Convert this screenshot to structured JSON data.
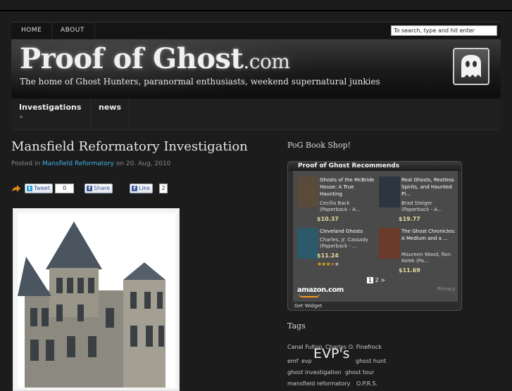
{
  "nav": {
    "home": "HOME",
    "about": "ABOUT",
    "search_placeholder": "To search, type and hit enter"
  },
  "banner": {
    "title_main": "Proof of Ghost",
    "title_suffix": ".com",
    "tagline": "The home of Ghost Hunters, paranormal enthusiasts, weekend supernatural junkies"
  },
  "mainnav": {
    "investigations": "Investigations",
    "investigations_arrow": "»",
    "news": "news"
  },
  "post": {
    "title": "Mansfield Reformatory Investigation",
    "posted_in_label": "Posted in",
    "category": "Mansfield Reformatory",
    "on_label": "on",
    "date": "20. Aug, 2010"
  },
  "share": {
    "tweet_label": "Tweet",
    "tweet_count": "0",
    "share_label": "Share",
    "like_label": "Like",
    "like_count": "2"
  },
  "sidebar": {
    "shop_heading": "PoG Book Shop!",
    "widget_title": "Proof of Ghost Recommends",
    "books": [
      {
        "title": "Ghosts of the McBride House: A True Haunting",
        "author": "Cecilia Back (Paperback - A...",
        "price": "$10.37",
        "rating": null,
        "cover_color": "#5a4a3a"
      },
      {
        "title": "Real Ghosts, Restless Spirits, and Haunted Pl...",
        "author": "Brad Steiger (Paperback - A...",
        "price": "$19.77",
        "rating": null,
        "cover_color": "#2d3540"
      },
      {
        "title": "Cleveland Ghosts",
        "author": "Charles, Jr. Cassady (Paperback - ...",
        "price": "$11.24",
        "rating": 3.5,
        "cover_color": "#2c5a6a"
      },
      {
        "title": "The Ghost Chronicles: A Medium and a ...",
        "author": "Maureen Wood, Ron Kolek (Pa...",
        "price": "$11.69",
        "rating": null,
        "cover_color": "#6a3a2a"
      }
    ],
    "pager": {
      "current": "1",
      "next": "2",
      "arrow": ">"
    },
    "amazon": "amazon.com",
    "privacy": "Privacy",
    "get_widget": "Get Widget",
    "tags_heading": "Tags",
    "tags": [
      "Canal Fulton",
      "Charles O. Finefrock",
      "emf",
      "evp",
      "EVP's",
      "ghost hunt",
      "ghost investigation",
      "ghost tour",
      "mansfield reformatory",
      "O.P.R.S."
    ]
  },
  "colors": {
    "background": "#1c1c1c",
    "link": "#3fb3e8",
    "accent_orange": "#f29a1f"
  }
}
